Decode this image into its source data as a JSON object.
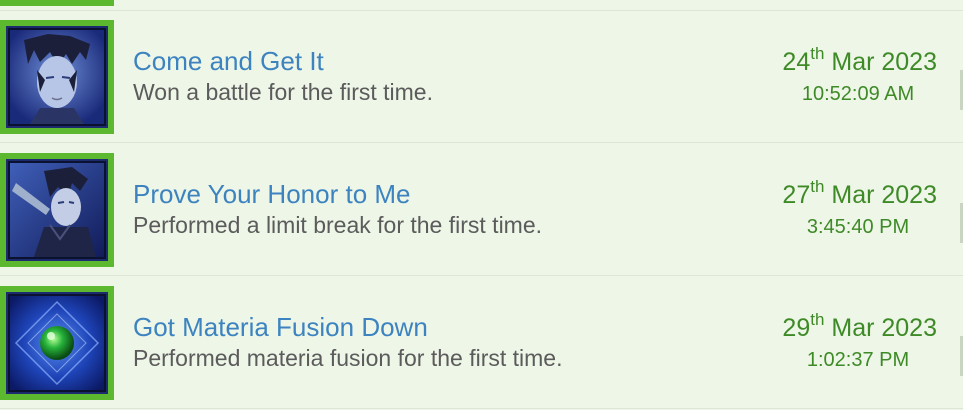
{
  "trophies": [
    {
      "title": "Come and Get It",
      "description": "Won a battle for the first time.",
      "day": "24",
      "day_suffix": "th",
      "month_year": "Mar 2023",
      "time": "10:52:09 AM",
      "icon": "zack-portrait-icon"
    },
    {
      "title": "Prove Your Honor to Me",
      "description": "Performed a limit break for the first time.",
      "day": "27",
      "day_suffix": "th",
      "month_year": "Mar 2023",
      "time": "3:45:40 PM",
      "icon": "zack-limit-break-icon"
    },
    {
      "title": "Got Materia Fusion Down",
      "description": "Performed materia fusion for the first time.",
      "day": "29",
      "day_suffix": "th",
      "month_year": "Mar 2023",
      "time": "1:02:37 PM",
      "icon": "green-materia-icon"
    }
  ],
  "colors": {
    "background": "#eef6e8",
    "frame_green": "#5cb82f",
    "title_blue": "#3c83bf",
    "date_green": "#3e8a27",
    "description_gray": "#5b5b5b"
  }
}
